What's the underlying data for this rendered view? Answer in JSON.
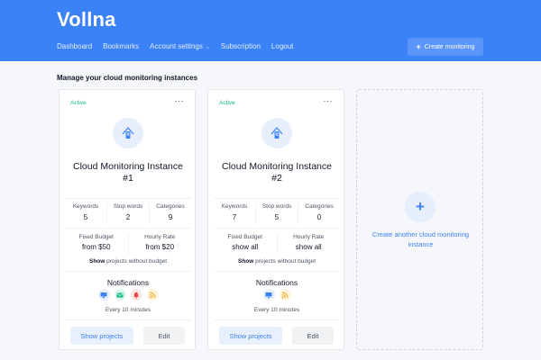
{
  "app": {
    "logo": "Vollna"
  },
  "nav": {
    "dashboard": "Dashboard",
    "bookmarks": "Bookmarks",
    "account_settings": "Account settings",
    "subscription": "Subscription",
    "logout": "Logout"
  },
  "header": {
    "create_button": "Create monitoring"
  },
  "page": {
    "heading": "Manage your cloud monitoring instances"
  },
  "colors": {
    "primary": "#3b82f6",
    "active": "#10b981",
    "background": "#f5f7fa"
  },
  "cards": [
    {
      "status": "Active",
      "more": "···",
      "title_line1": "Cloud Monitoring Instance",
      "title_line2": "#1",
      "stats": [
        {
          "label": "Keywords",
          "value": "5"
        },
        {
          "label": "Stop words",
          "value": "2"
        },
        {
          "label": "Categories",
          "value": "9"
        }
      ],
      "budget": [
        {
          "label": "Fixed Budget",
          "value": "from $50"
        },
        {
          "label": "Hourly Rate",
          "value": "from $20"
        }
      ],
      "show_strong": "Show",
      "show_rest": " projects without budget",
      "notifications_title": "Notifications",
      "notification_icons": [
        "desktop-icon",
        "email-icon",
        "bell-icon",
        "rss-icon"
      ],
      "frequency": "Every 10 minutes",
      "show_projects": "Show projects",
      "edit": "Edit"
    },
    {
      "status": "Active",
      "more": "···",
      "title_line1": "Cloud Monitoring Instance",
      "title_line2": "#2",
      "stats": [
        {
          "label": "Keywords",
          "value": "7"
        },
        {
          "label": "Stop words",
          "value": "5"
        },
        {
          "label": "Categories",
          "value": "0"
        }
      ],
      "budget": [
        {
          "label": "Fixed Budget",
          "value": "show all"
        },
        {
          "label": "Hourly Rate",
          "value": "show all"
        }
      ],
      "show_strong": "Show",
      "show_rest": " projects without budget",
      "notifications_title": "Notifications",
      "notification_icons": [
        "desktop-icon",
        "rss-icon"
      ],
      "frequency": "Every 10 minutes",
      "show_projects": "Show projects",
      "edit": "Edit"
    }
  ],
  "add_card": {
    "plus": "+",
    "text": "Create another cloud monitoring instance"
  }
}
